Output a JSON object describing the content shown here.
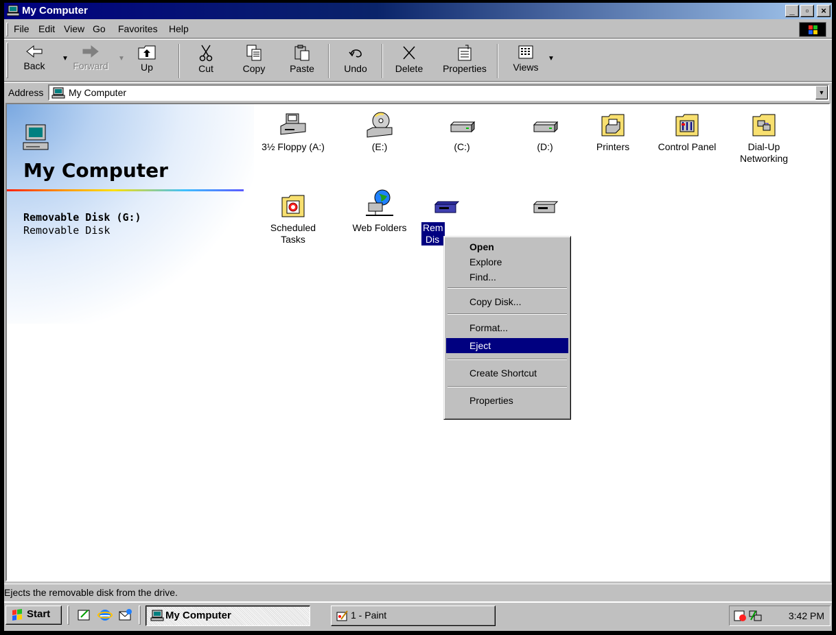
{
  "window": {
    "title": "My Computer"
  },
  "menu": {
    "file": "File",
    "edit": "Edit",
    "view": "View",
    "go": "Go",
    "favorites": "Favorites",
    "help": "Help"
  },
  "toolbar": {
    "back": "Back",
    "forward": "Forward",
    "up": "Up",
    "cut": "Cut",
    "copy": "Copy",
    "paste": "Paste",
    "undo": "Undo",
    "delete": "Delete",
    "properties": "Properties",
    "views": "Views"
  },
  "address": {
    "label": "Address",
    "value": "My Computer"
  },
  "sidebar": {
    "title": "My Computer",
    "selected_name": "Removable Disk (G:)",
    "selected_type": "Removable Disk"
  },
  "icons": {
    "floppy": "3½ Floppy (A:)",
    "cd_e": "(E:)",
    "drive_c": "(C:)",
    "drive_d": "(D:)",
    "printers": "Printers",
    "control_panel": "Control Panel",
    "dialup_1": "Dial-Up",
    "dialup_2": "Networking",
    "scheduled_1": "Scheduled",
    "scheduled_2": "Tasks",
    "web_folders": "Web Folders",
    "removable_1": "Rem",
    "removable_2": "Dis"
  },
  "context_menu": {
    "open": "Open",
    "explore": "Explore",
    "find": "Find...",
    "copy_disk": "Copy Disk...",
    "format": "Format...",
    "eject": "Eject",
    "create_shortcut": "Create Shortcut",
    "properties": "Properties"
  },
  "status": {
    "text": "Ejects the removable disk from the drive."
  },
  "taskbar": {
    "start": "Start",
    "task_1": "My Computer",
    "task_2": "1 - Paint",
    "clock": "3:42 PM"
  },
  "colors": {
    "title_active": "#000080",
    "selection": "#000080",
    "face": "#c0c0c0"
  }
}
